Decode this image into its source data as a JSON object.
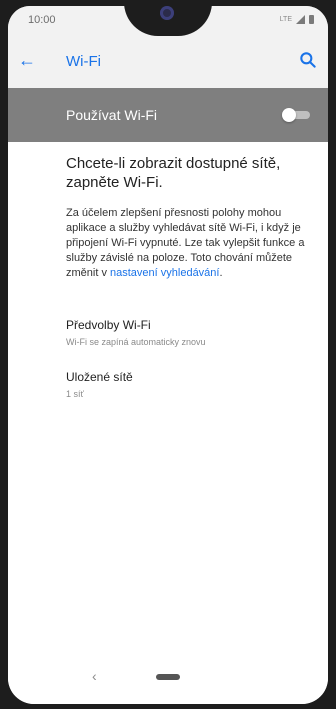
{
  "status_bar": {
    "time": "10:00",
    "network": "LTE"
  },
  "app_bar": {
    "title": "Wi-Fi",
    "back_icon": "arrow-back-icon",
    "search_icon": "search-icon"
  },
  "wifi_toggle": {
    "label": "Používat Wi-Fi",
    "enabled": false
  },
  "intro_text": "Chcete-li zobrazit dostupné sítě, zapněte Wi-Fi.",
  "description": {
    "text": "Za účelem zlepšení přesnosti polohy mohou aplikace a služby vyhledávat sítě Wi-Fi, i když je připojení Wi-Fi vypnuté. Lze tak vylepšit funkce a služby závislé na poloze. Toto chování můžete změnit v ",
    "link": "nastavení vyhledávání",
    "after": "."
  },
  "preferences": {
    "title": "Předvolby Wi-Fi",
    "subtitle": "Wi-Fi se zapíná automaticky znovu"
  },
  "saved_networks": {
    "title": "Uložené sítě",
    "subtitle": "1 síť"
  },
  "nav_bar": {
    "back_glyph": "‹"
  },
  "colors": {
    "accent": "#1a73e8",
    "toggle_row_bg": "#7f7f7f",
    "appbar_bg": "#f2f2f2"
  }
}
